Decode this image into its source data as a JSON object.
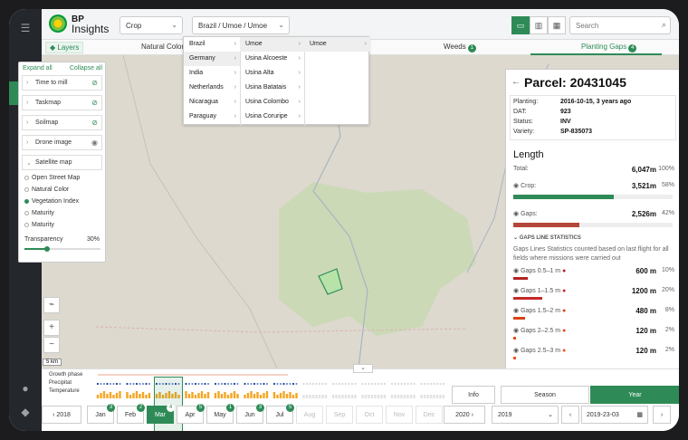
{
  "app": {
    "name_line1": "BP",
    "name_line2": "Insights"
  },
  "topbar": {
    "crop_select": "Crop",
    "location_select": "Brazil / Umoe / Umoe",
    "search_placeholder": "Search"
  },
  "tabs": {
    "layers": "Layers",
    "natural_color": "Natural Color",
    "weeds": "Weeds",
    "weeds_count": "1",
    "planting_gaps": "Planting Gaps",
    "planting_gaps_count": "4"
  },
  "dropdown": {
    "col1": [
      "Brazil",
      "Germany",
      "India",
      "Netherlands",
      "Nicaragua",
      "Paraguay"
    ],
    "col2": [
      "Umoe",
      "Usina Alcoeste",
      "Usina Alta",
      "Usina Batatais",
      "Usina Colombo",
      "Usina Coruripe"
    ],
    "col3": [
      "Umoe"
    ]
  },
  "layer_panel": {
    "expand_all": "Expand all",
    "collapse_all": "Collapse all",
    "items": [
      "Time to mill",
      "Taskmap",
      "Soilmap",
      "Drone image",
      "Satellite map"
    ],
    "satellite_options": [
      "Open Street Map",
      "Natural Color",
      "Vegetation Index",
      "Maturity",
      "Maturity"
    ],
    "transparency_label": "Transparency",
    "transparency_value": "30%",
    "transparency_fraction": 0.3
  },
  "map": {
    "scale": "5 km",
    "zoom_in": "+",
    "zoom_out": "−"
  },
  "parcel": {
    "title": "Parcel: 20431045",
    "planting_label": "Planting:",
    "planting_value": "2016-10-15, 3 years ago",
    "dat_label": "DAT:",
    "dat_value": "923",
    "status_label": "Status:",
    "status_value": "INV",
    "variety_label": "Variety:",
    "variety_value": "SP-835073",
    "length_title": "Length",
    "total_label": "Total:",
    "total_value": "6,047m",
    "total_pct": "100%",
    "crop_label": "Crop:",
    "crop_value": "3,521m",
    "crop_pct": "58%",
    "crop_fraction": 0.58,
    "gaps_label": "Gaps:",
    "gaps_value": "2,526m",
    "gaps_pct": "42%",
    "gaps_fraction": 0.42,
    "gls_title": "GAPS LINE STATISTICS",
    "gls_desc": "Gaps Lines Statistics counted based on last flight for all fields where missions were carried out",
    "gap_rows": [
      {
        "label": "Gaps 0.5–1 m",
        "value": "600 m",
        "pct": "10%",
        "fraction": 0.1,
        "color": "#b22222"
      },
      {
        "label": "Gaps 1–1.5 m",
        "value": "1200 m",
        "pct": "20%",
        "fraction": 0.2,
        "color": "#c62828"
      },
      {
        "label": "Gaps 1.5–2 m",
        "value": "480 m",
        "pct": "8%",
        "fraction": 0.08,
        "color": "#d84315"
      },
      {
        "label": "Gaps 2–2.5 m",
        "value": "120 m",
        "pct": "2%",
        "fraction": 0.02,
        "color": "#e64a19"
      },
      {
        "label": "Gaps 2.5–3 m",
        "value": "120 m",
        "pct": "2%",
        "fraction": 0.02,
        "color": "#f4511e"
      }
    ],
    "crop_color": "#2e8b57",
    "gaps_color": "#b5473a"
  },
  "bottom": {
    "growth_label": "Growth phase",
    "precip_label": "Precipitat",
    "temp_label": "Temperature",
    "prev_year": "2018",
    "next_year": "2020",
    "months": [
      {
        "name": "Jan",
        "badge": "3",
        "state": "normal"
      },
      {
        "name": "Feb",
        "badge": "2",
        "state": "normal"
      },
      {
        "name": "Mar",
        "badge": "4",
        "state": "active"
      },
      {
        "name": "Apr",
        "badge": "5",
        "state": "normal"
      },
      {
        "name": "May",
        "badge": "1",
        "state": "normal"
      },
      {
        "name": "Jun",
        "badge": "3",
        "state": "normal"
      },
      {
        "name": "Jul",
        "badge": "5",
        "state": "normal"
      },
      {
        "name": "Aug",
        "badge": "",
        "state": "dis"
      },
      {
        "name": "Sep",
        "badge": "",
        "state": "dis"
      },
      {
        "name": "Oct",
        "badge": "",
        "state": "dis"
      },
      {
        "name": "Nov",
        "badge": "",
        "state": "dis"
      },
      {
        "name": "Dec",
        "badge": "",
        "state": "dis"
      }
    ],
    "info": "Info",
    "season": "Season",
    "year": "Year",
    "year_select": "2019",
    "date": "2019-23-03"
  }
}
